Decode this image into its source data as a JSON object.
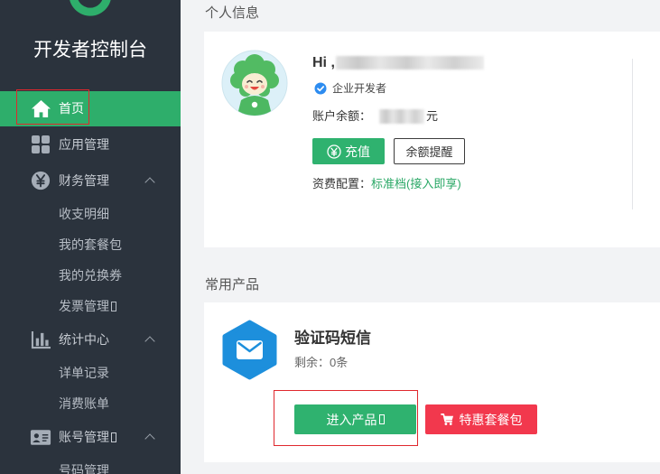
{
  "app": {
    "title": "开发者控制台",
    "logo_icon": "brand-logo-icon"
  },
  "colors": {
    "sidebar_bg": "#2b333d",
    "accent_green": "#2eae6b",
    "link_green": "#2aa866",
    "danger_red": "#f2384d",
    "badge_blue": "#2d8cf0",
    "product_icon_blue": "#1d8fdc",
    "highlight_red": "#e0282e"
  },
  "sidebar": {
    "items": [
      {
        "label": "首页",
        "icon": "home-icon",
        "active": true
      },
      {
        "label": "应用管理",
        "icon": "grid-icon"
      },
      {
        "label": "财务管理",
        "icon": "yen-circle-icon",
        "expanded": true,
        "children": [
          {
            "label": "收支明细"
          },
          {
            "label": "我的套餐包"
          },
          {
            "label": "我的兑换券"
          },
          {
            "label": "发票管理",
            "suffix_icon": "missing-glyph-icon"
          }
        ]
      },
      {
        "label": "统计中心",
        "icon": "bar-chart-icon",
        "expanded": true,
        "children": [
          {
            "label": "详单记录"
          },
          {
            "label": "消费账单"
          }
        ]
      },
      {
        "label": "账号管理",
        "icon": "id-card-icon",
        "suffix_icon": "missing-glyph-icon",
        "expanded": true,
        "children": [
          {
            "label": "号码管理"
          }
        ]
      }
    ]
  },
  "profile": {
    "section_title": "个人信息",
    "avatar_icon": "mascot-avatar",
    "greeting": "Hi ,",
    "account_type": "企业开发者",
    "account_type_icon": "verified-badge-icon",
    "balance_label": "账户余额：",
    "balance_unit": "元",
    "recharge_button": "充值",
    "recharge_icon": "yen-circle-icon",
    "reminder_button": "余额提醒",
    "plan_label": "资费配置：",
    "plan_value": "标准档(接入即享)"
  },
  "products": {
    "section_title": "常用产品",
    "items": [
      {
        "name": "验证码短信",
        "icon": "envelope-hexagon-icon",
        "remaining": "剩余：0条",
        "enter_button": "进入产品",
        "enter_suffix_icon": "missing-glyph-icon",
        "package_button": "特惠套餐包",
        "package_icon": "cart-icon"
      }
    ]
  }
}
